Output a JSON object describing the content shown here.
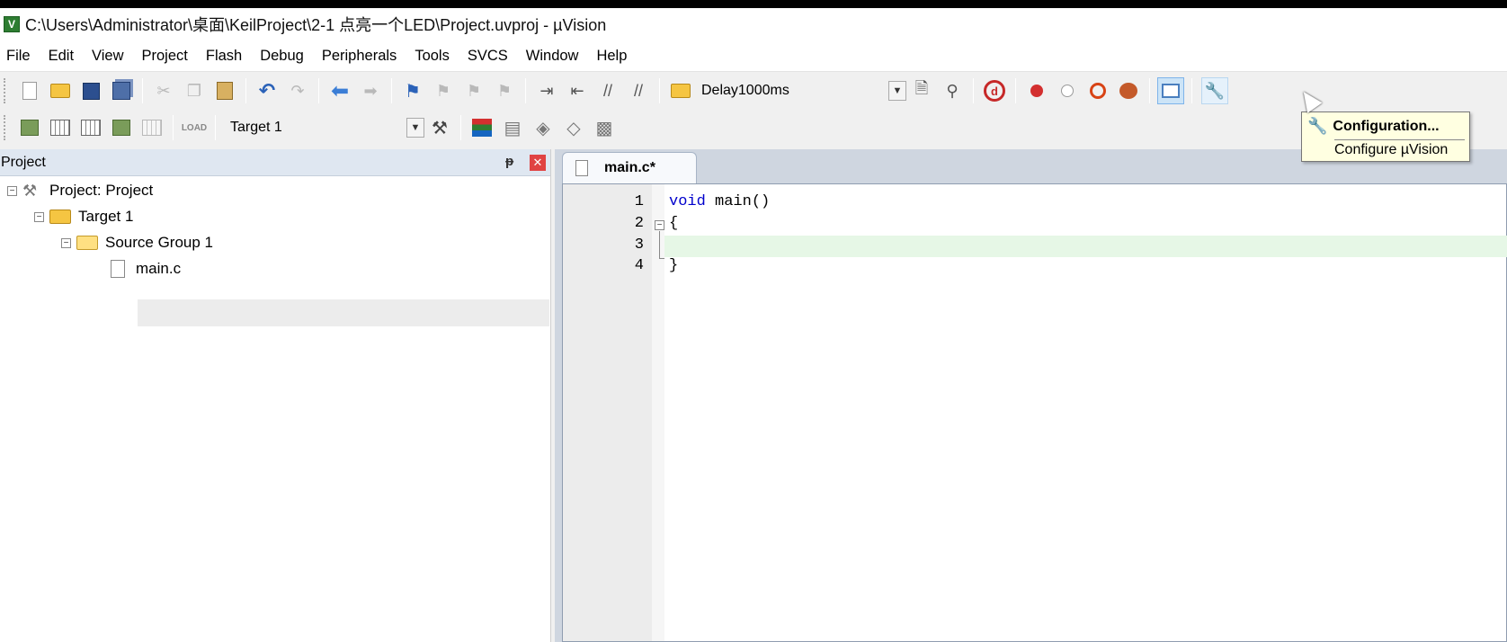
{
  "window": {
    "title": "C:\\Users\\Administrator\\桌面\\KeilProject\\2-1 点亮一个LED\\Project.uvproj - µVision",
    "icon": "keil-uvision-icon"
  },
  "menu": [
    "File",
    "Edit",
    "View",
    "Project",
    "Flash",
    "Debug",
    "Peripherals",
    "Tools",
    "SVCS",
    "Window",
    "Help"
  ],
  "toolbar": {
    "find_value": "Delay1000ms",
    "target_value": "Target 1"
  },
  "tooltip": {
    "title": "Configuration...",
    "description": "Configure µVision"
  },
  "project_panel": {
    "title": "Project",
    "tree": [
      {
        "label": "Project: Project"
      },
      {
        "label": "Target 1"
      },
      {
        "label": "Source Group 1"
      },
      {
        "label": "main.c"
      }
    ]
  },
  "editor": {
    "tab_label": "main.c*",
    "lines": [
      {
        "num": "1",
        "keyword": "void",
        "rest": " main()"
      },
      {
        "num": "2",
        "keyword": "",
        "rest": "{"
      },
      {
        "num": "3",
        "keyword": "",
        "rest": ""
      },
      {
        "num": "4",
        "keyword": "",
        "rest": "}"
      }
    ]
  }
}
